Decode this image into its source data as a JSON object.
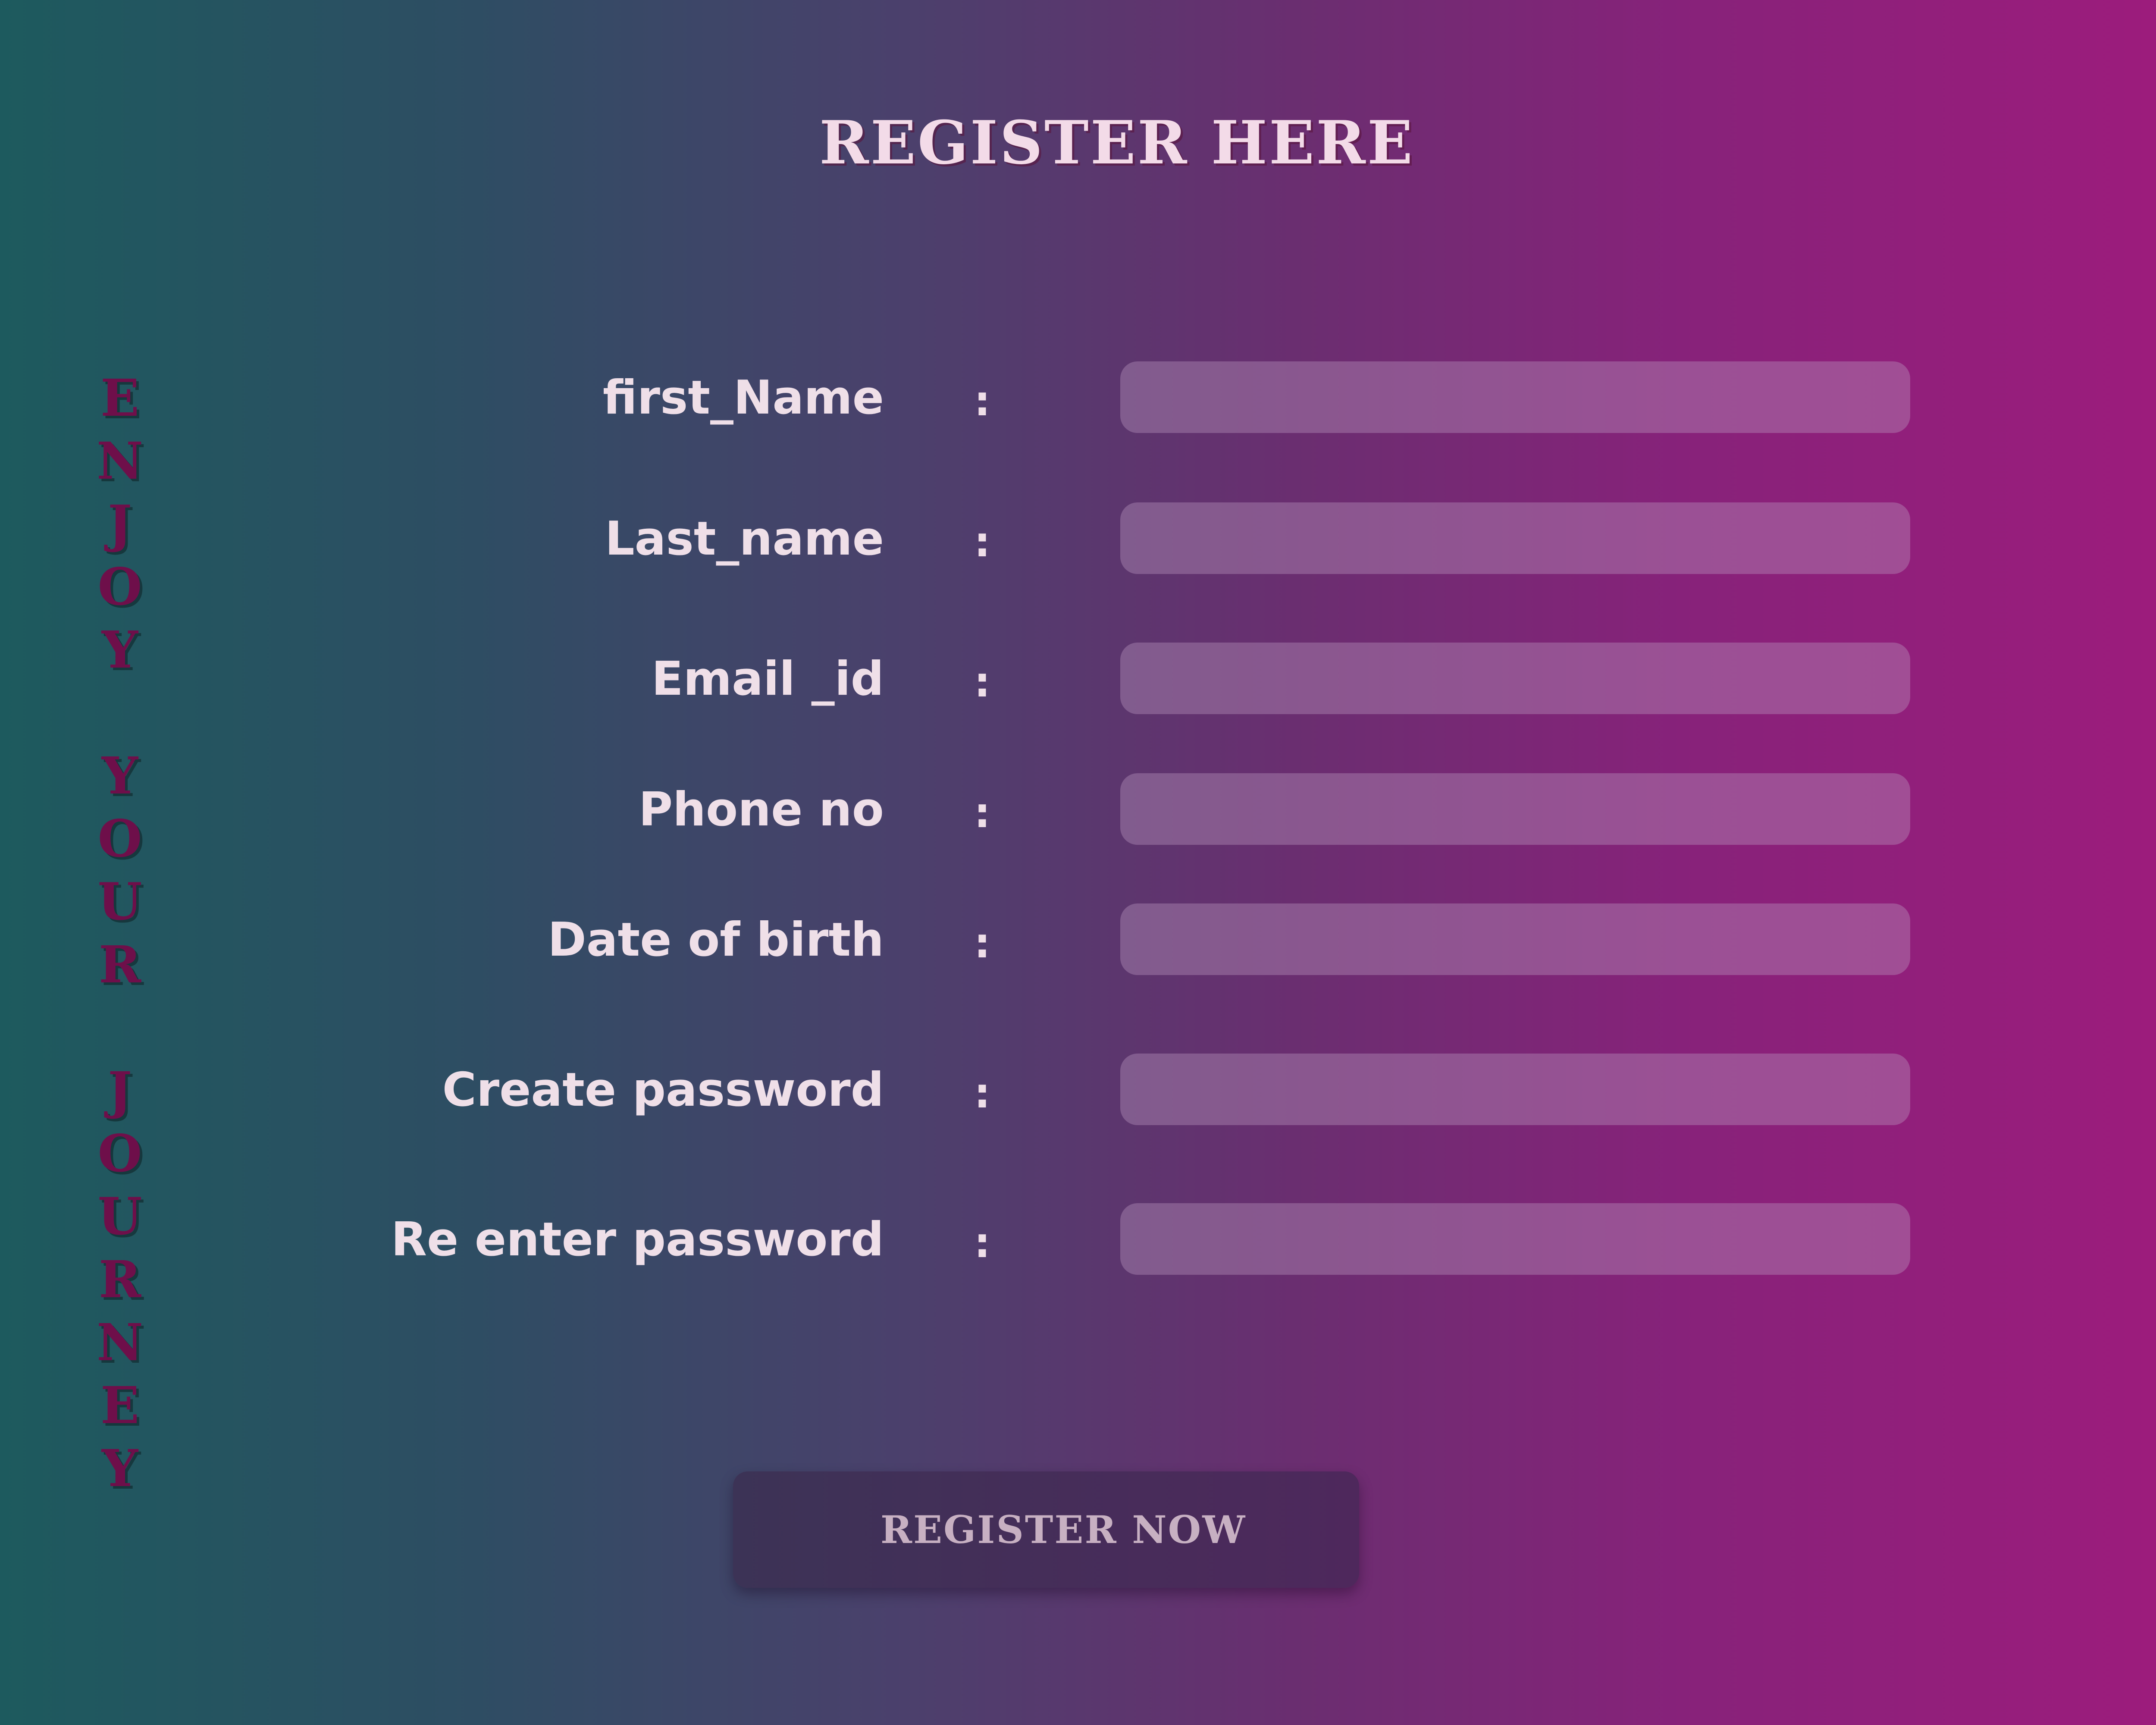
{
  "header": {
    "title": "REGISTER HERE"
  },
  "side_banner": {
    "text": "E\nN\nJ\nO\nY\n \nY\nO\nU\nR\n \nJ\nO\nU\nR\nN\nE\nY"
  },
  "form": {
    "separator": ":",
    "fields": [
      {
        "label": "first_Name",
        "value": ""
      },
      {
        "label": "Last_name",
        "value": ""
      },
      {
        "label": "Email _id",
        "value": ""
      },
      {
        "label": "Phone no",
        "value": ""
      },
      {
        "label": "Date of birth",
        "value": ""
      },
      {
        "label": "Create password",
        "value": ""
      },
      {
        "label": "Re enter password",
        "value": ""
      }
    ],
    "submit_label": "REGISTER NOW"
  },
  "colors": {
    "gradient_start": "#1d5a5e",
    "gradient_end": "#9c1c7c",
    "title_text": "#f3dbe8",
    "side_text": "#6e0f4a",
    "label_text": "#efdfe8",
    "button_text": "#c7b0c2"
  }
}
